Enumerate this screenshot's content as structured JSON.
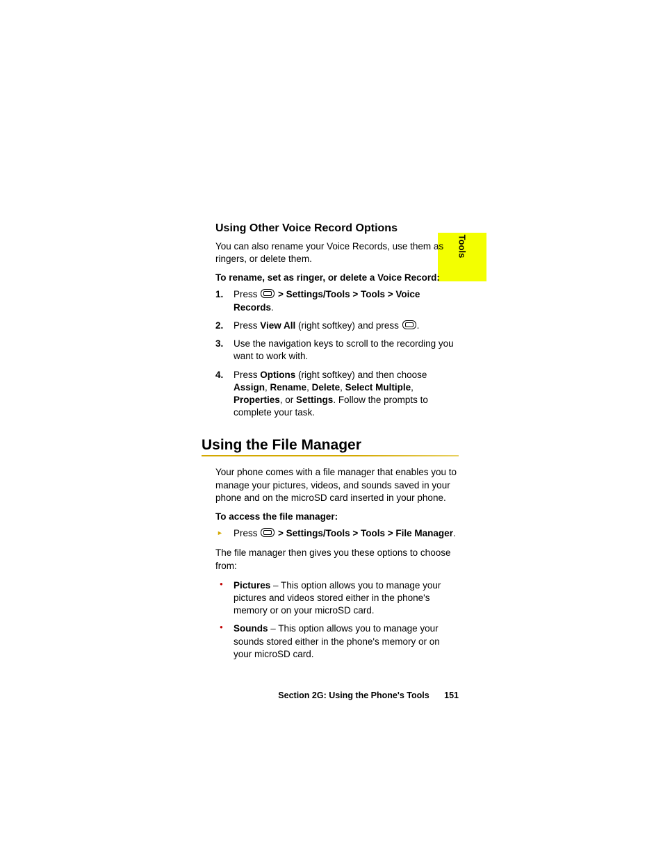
{
  "sideTab": "Tools",
  "sub1": {
    "heading": "Using Other Voice Record Options",
    "intro": "You can also rename your Voice Records, use them as ringers, or delete them.",
    "lead": "To rename, set as ringer, or delete a Voice Record:",
    "steps": {
      "s1_a": "Press ",
      "s1_b": " > Settings/Tools > Tools > Voice Records",
      "s1_c": ".",
      "s2_a": "Press ",
      "s2_b": "View All",
      "s2_c": " (right softkey) and press ",
      "s2_d": ".",
      "s3": "Use the navigation keys to scroll to the recording you want to work with.",
      "s4_a": "Press ",
      "s4_b": "Options",
      "s4_c": " (right softkey) and then choose ",
      "s4_d": "Assign",
      "s4_e": ", ",
      "s4_f": "Rename",
      "s4_g": ", ",
      "s4_h": "Delete",
      "s4_i": ", ",
      "s4_j": "Select Multiple",
      "s4_k": ", ",
      "s4_l": "Properties",
      "s4_m": ", or ",
      "s4_n": "Settings",
      "s4_o": ". Follow the prompts to complete your task."
    }
  },
  "sec2": {
    "heading": "Using the File Manager",
    "intro": "Your phone comes with a file manager that enables you to manage your pictures, videos, and sounds saved in your phone and on the microSD card inserted in your phone.",
    "lead": "To access the file manager:",
    "arrow_a": "Press ",
    "arrow_b": " > Settings/Tools > Tools > File Manager",
    "arrow_c": ".",
    "after": "The file manager then gives you these options to choose from:",
    "bullets": {
      "b1_a": "Pictures",
      "b1_b": " – This option allows you to manage your pictures and videos stored either in the phone's memory or on your microSD card.",
      "b2_a": "Sounds",
      "b2_b": " – This option allows you to manage your sounds stored either in the phone's memory or on your microSD card."
    }
  },
  "footer": {
    "section": "Section 2G: Using the Phone's Tools",
    "page": "151"
  },
  "nums": {
    "n1": "1.",
    "n2": "2.",
    "n3": "3.",
    "n4": "4."
  }
}
